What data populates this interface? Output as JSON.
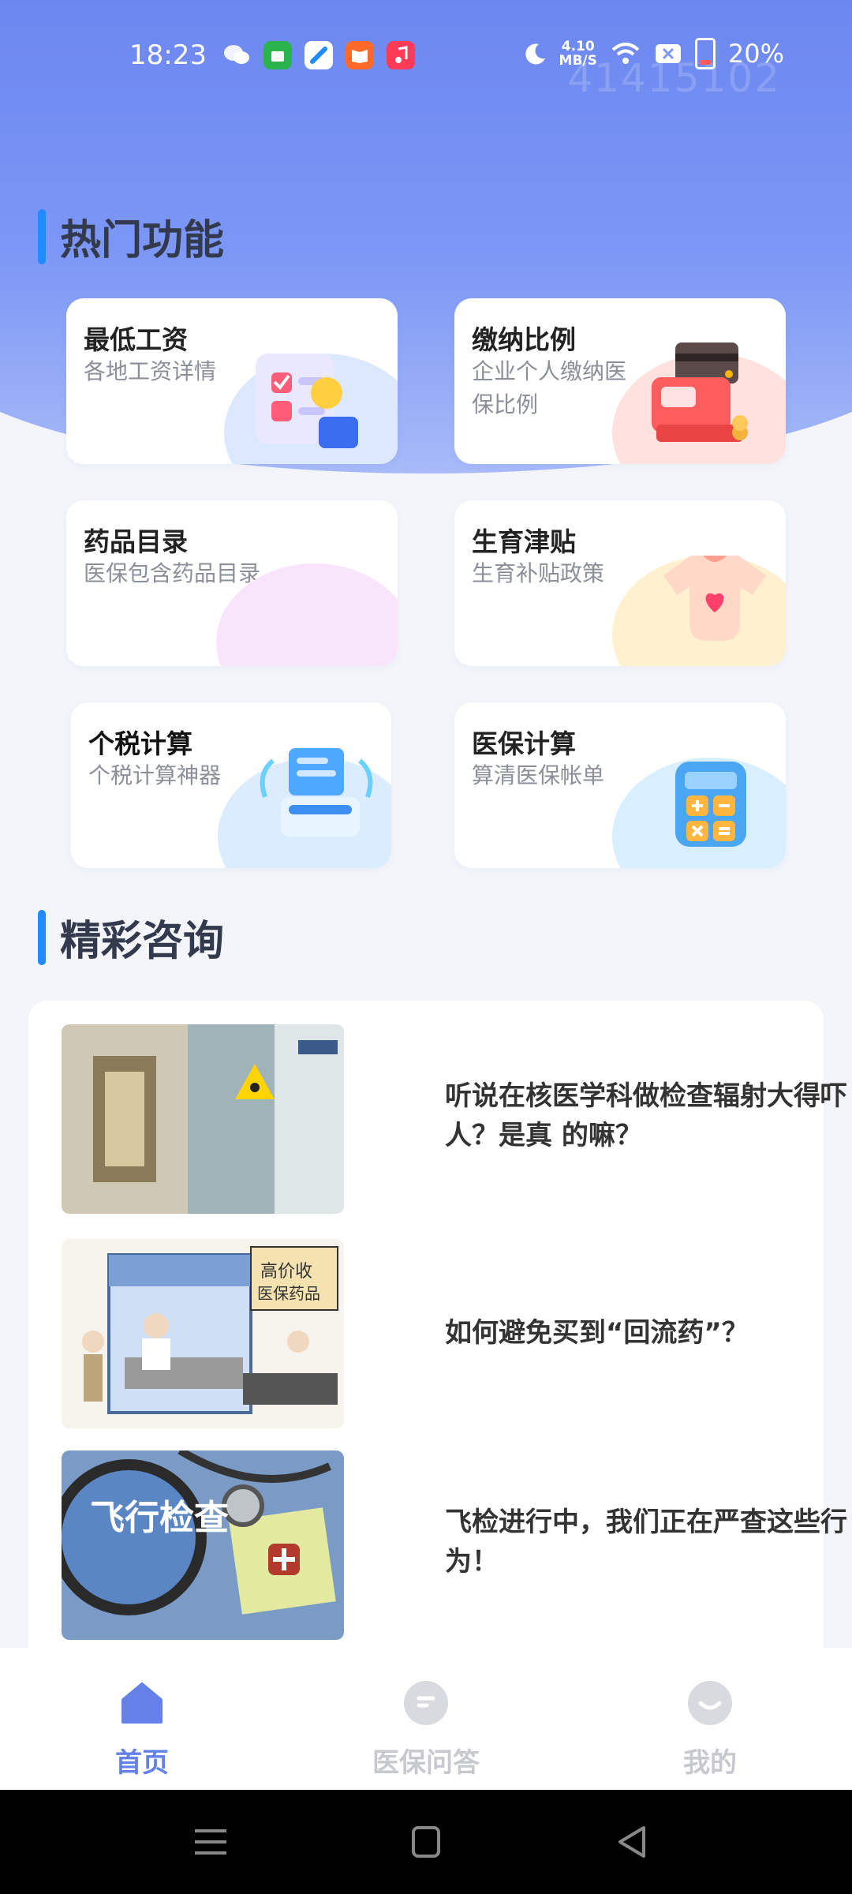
{
  "status_bar": {
    "time": "18:23",
    "speed_value": "4.10",
    "speed_unit": "MB/S",
    "battery": "20%",
    "watermark": "41415102"
  },
  "sections": {
    "hot_title": "热门功能",
    "news_title": "精彩咨询"
  },
  "cards": [
    {
      "title": "最低工资",
      "subtitle": "各地工资详情",
      "icon": "form-hand-icon"
    },
    {
      "title": "缴纳比例",
      "subtitle": "企业个人缴纳医保比例",
      "icon": "cash-register-icon"
    },
    {
      "title": "药品目录",
      "subtitle": "医保包含药品目录",
      "icon": "pink-blob-icon"
    },
    {
      "title": "生育津贴",
      "subtitle": "生育补贴政策",
      "icon": "baby-onesie-icon"
    },
    {
      "title": "个税计算",
      "subtitle": "个税计算神器",
      "icon": "data-box-icon"
    },
    {
      "title": "医保计算",
      "subtitle": "算清医保帐单",
      "icon": "calculator-icon"
    }
  ],
  "news": [
    {
      "title": "听说在核医学科做检查辐射大得吓人？是真 的嘛？",
      "image": "hospital-corridor-image"
    },
    {
      "title": "如何避免买到“回流药”？",
      "image": "pharmacy-cartoon-image"
    },
    {
      "title": "飞检进行中，我们正在严查这些行为！",
      "image": "inspection-magnifier-image",
      "image_text": "飞行检查"
    }
  ],
  "bottom_nav": [
    {
      "label": "首页",
      "active": true,
      "icon": "home-icon"
    },
    {
      "label": "医保问答",
      "active": false,
      "icon": "chat-icon"
    },
    {
      "label": "我的",
      "active": false,
      "icon": "smile-icon"
    }
  ],
  "colors": {
    "accent": "#6381e9",
    "section_bar": "#1f8bff",
    "inactive": "#c7c9ce"
  }
}
